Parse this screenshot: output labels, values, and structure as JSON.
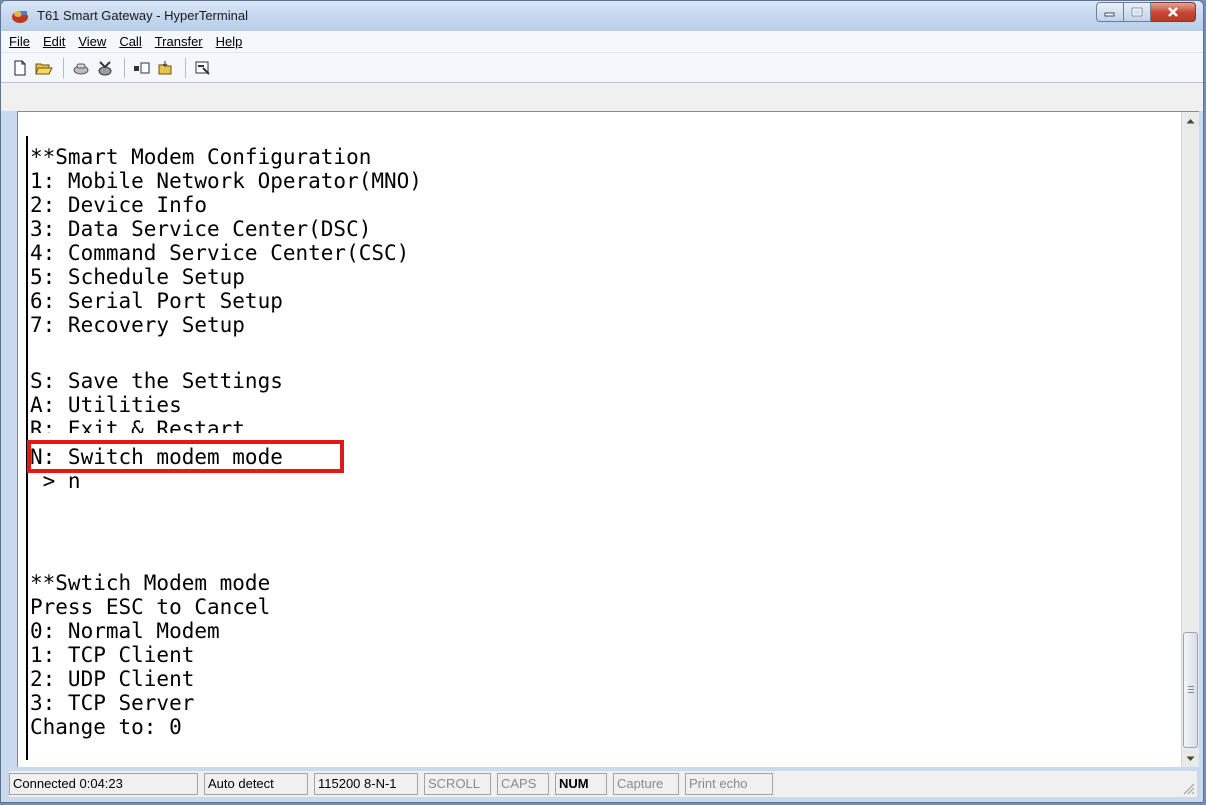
{
  "window": {
    "title": "T61 Smart Gateway - HyperTerminal"
  },
  "menu": [
    {
      "label": "File"
    },
    {
      "label": "Edit"
    },
    {
      "label": "View"
    },
    {
      "label": "Call"
    },
    {
      "label": "Transfer"
    },
    {
      "label": "Help"
    }
  ],
  "toolbar": {
    "icons": [
      "new-document-icon",
      "open-folder-icon",
      "disconnect-phone-icon",
      "dial-phone-icon",
      "send-file-icon",
      "receive-file-icon",
      "properties-icon"
    ]
  },
  "terminal": {
    "lines": [
      "**Smart Modem Configuration",
      "1: Mobile Network Operator(MNO)",
      "2: Device Info",
      "3: Data Service Center(DSC)",
      "4: Command Service Center(CSC)",
      "5: Schedule Setup",
      "6: Serial Port Setup",
      "7: Recovery Setup",
      "",
      "S: Save the Settings",
      "A: Utilities",
      "R: Exit & Restart",
      "N: Switch modem mode",
      " > n",
      "",
      "",
      "",
      "**Swtich Modem mode",
      "Press ESC to Cancel",
      "0: Normal Modem",
      "1: TCP Client",
      "2: UDP Client",
      "3: TCP Server",
      "Change to: 0"
    ],
    "highlighted_line": "N: Switch modem mode",
    "highlight_color": "#e01a1a"
  },
  "status": {
    "connection": "Connected 0:04:23",
    "detect": "Auto detect",
    "port": "115200 8-N-1",
    "scroll": "SCROLL",
    "caps": "CAPS",
    "num": "NUM",
    "capture": "Capture",
    "print_echo": "Print echo"
  }
}
